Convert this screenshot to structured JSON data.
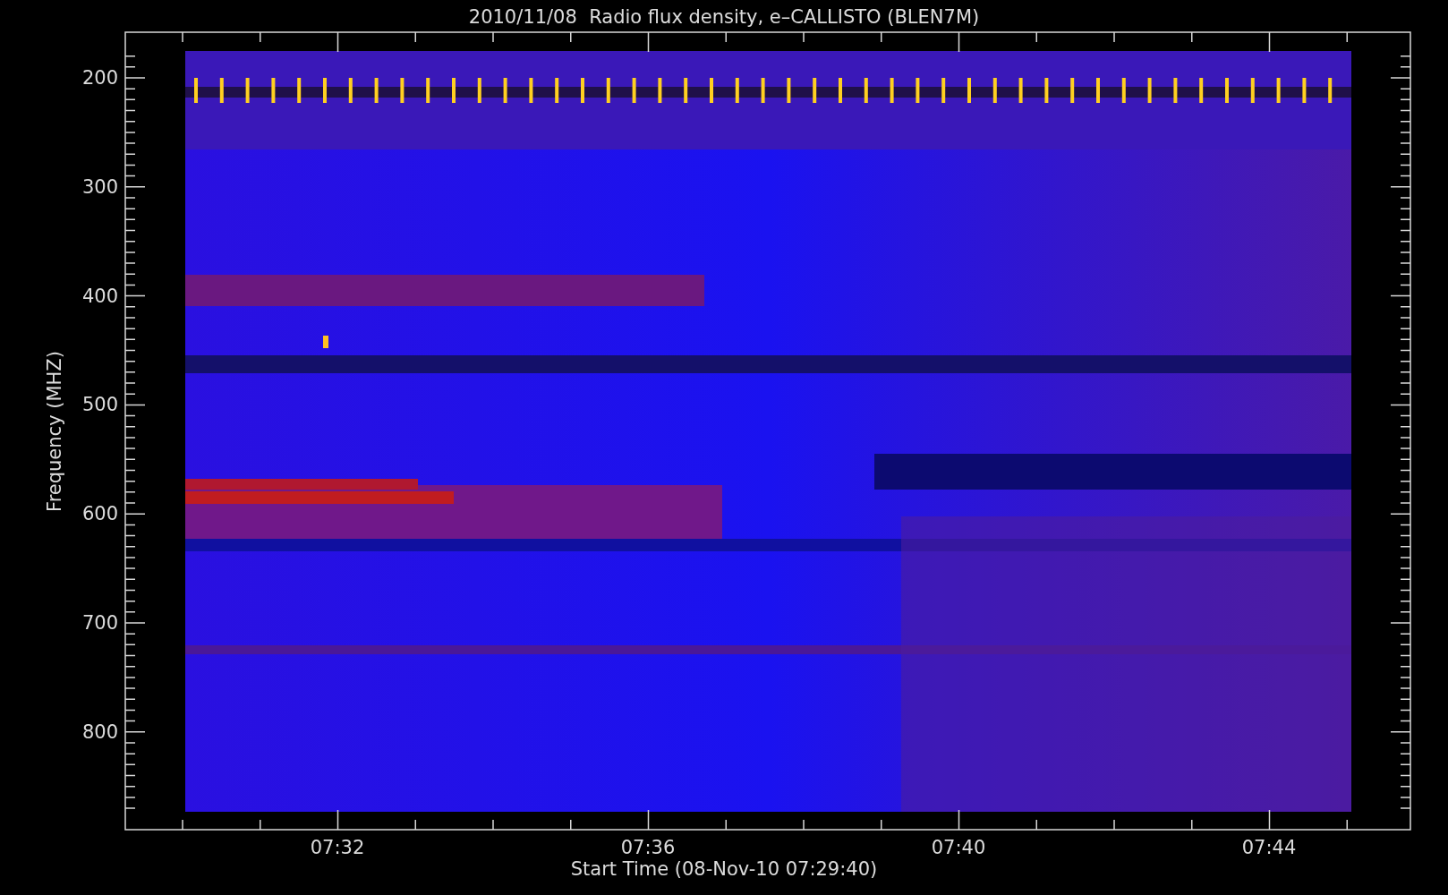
{
  "title": "2010/11/08  Radio flux density, e–CALLISTO (BLEN7M)",
  "y_axis": {
    "label": "Frequency (MHZ)",
    "ticks": [
      "200",
      "300",
      "400",
      "500",
      "600",
      "700",
      "800"
    ]
  },
  "x_axis": {
    "label": "Start Time (08-Nov-10 07:29:40)",
    "ticks": [
      "07:32",
      "07:36",
      "07:40",
      "07:44"
    ]
  }
}
